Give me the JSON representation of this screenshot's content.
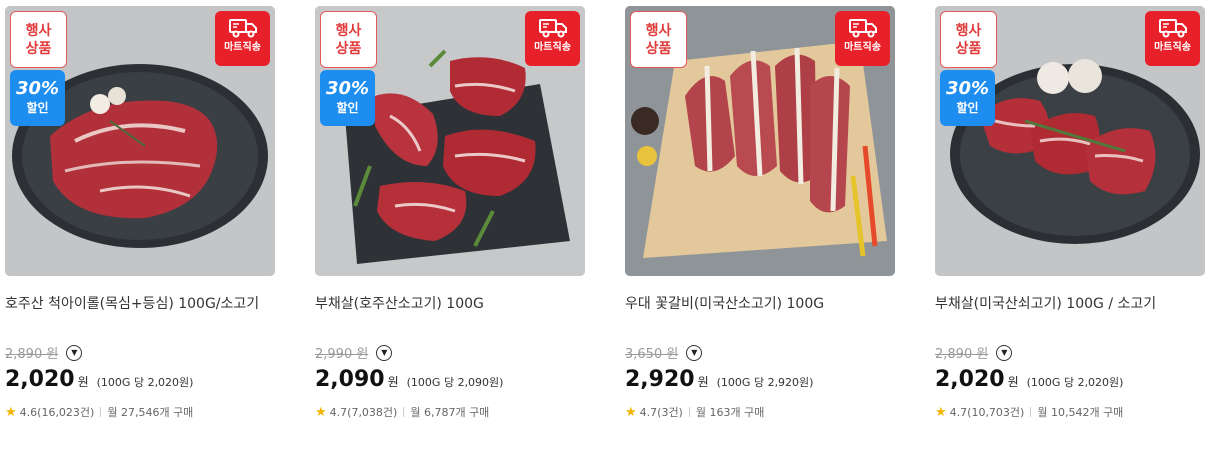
{
  "products": [
    {
      "badge_event": [
        "행사",
        "상품"
      ],
      "badge_discount": {
        "pct": "30%",
        "label": "할인"
      },
      "badge_delivery": "마트직송",
      "name": "호주산 척아이롤(목심+등심) 100G/소고기",
      "original_price": "2,890 원",
      "price": "2,020",
      "won": "원",
      "unit_price": "(100G 당 2,020원)",
      "rating": "4.6(16,023건)",
      "sales": "월 27,546개 구매"
    },
    {
      "badge_event": [
        "행사",
        "상품"
      ],
      "badge_discount": {
        "pct": "30%",
        "label": "할인"
      },
      "badge_delivery": "마트직송",
      "name": "부채살(호주산소고기) 100G",
      "original_price": "2,990 원",
      "price": "2,090",
      "won": "원",
      "unit_price": "(100G 당 2,090원)",
      "rating": "4.7(7,038건)",
      "sales": "월 6,787개 구매"
    },
    {
      "badge_event": [
        "행사",
        "상품"
      ],
      "badge_discount": null,
      "badge_delivery": "마트직송",
      "name": "우대 꽃갈비(미국산소고기) 100G",
      "original_price": "3,650 원",
      "price": "2,920",
      "won": "원",
      "unit_price": "(100G 당 2,920원)",
      "rating": "4.7(3건)",
      "sales": "월 163개 구매"
    },
    {
      "badge_event": [
        "행사",
        "상품"
      ],
      "badge_discount": {
        "pct": "30%",
        "label": "할인"
      },
      "badge_delivery": "마트직송",
      "name": "부채살(미국산쇠고기) 100G / 소고기",
      "original_price": "2,890 원",
      "price": "2,020",
      "won": "원",
      "unit_price": "(100G 당 2,020원)",
      "rating": "4.7(10,703건)",
      "sales": "월 10,542개 구매"
    }
  ],
  "icons": {
    "dropdown": "chevron-down-circle-icon",
    "rating": "star-icon",
    "delivery": "truck-icon"
  },
  "colors": {
    "event_red": "#e03a3a",
    "discount_blue": "#1d8df0",
    "delivery_red": "#e8202a",
    "star": "#f4b400"
  }
}
